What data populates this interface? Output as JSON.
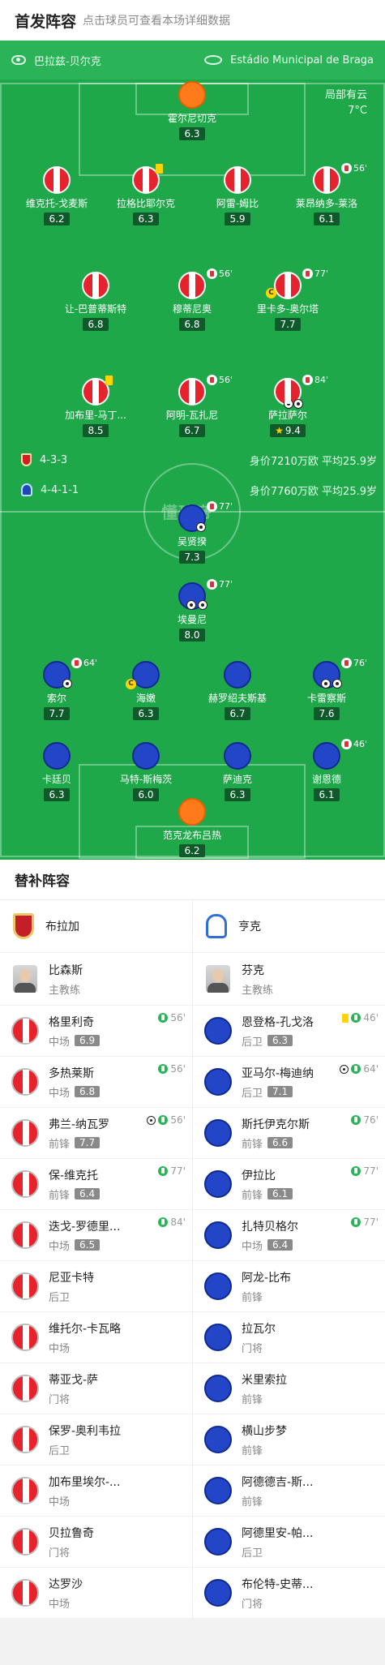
{
  "header": {
    "title": "首发阵容",
    "subtitle": "点击球员可查看本场详细数据"
  },
  "pitch": {
    "home_team": "巴拉兹-贝尔克",
    "stadium": "Estádio Municipal de Braga",
    "weather": "局部有云",
    "temperature": "7°C",
    "watermark": "懂球帝",
    "home_formation": "4-3-3",
    "home_value": "身价7210万欧 平均25.9岁",
    "away_formation": "4-4-1-1",
    "away_value": "身价7760万欧 平均25.9岁"
  },
  "home_players": [
    {
      "name": "霍尔尼切克",
      "rating": "6.3",
      "kit": "orange"
    },
    {
      "name": "维克托-戈麦斯",
      "rating": "6.2",
      "kit": "red"
    },
    {
      "name": "拉格比耶尔克",
      "rating": "6.3",
      "kit": "red"
    },
    {
      "name": "阿雷-姆比",
      "rating": "5.9",
      "kit": "red"
    },
    {
      "name": "莱昂纳多-莱洛",
      "rating": "6.1",
      "kit": "red",
      "sub": "56'"
    },
    {
      "name": "让-巴普蒂斯特",
      "rating": "6.8",
      "kit": "red"
    },
    {
      "name": "穆蒂尼奥",
      "rating": "6.8",
      "kit": "red",
      "sub": "56'"
    },
    {
      "name": "里卡多-奥尔塔",
      "rating": "7.7",
      "kit": "red",
      "sub": "77'"
    },
    {
      "name": "加布里-马丁...",
      "rating": "8.5",
      "kit": "red"
    },
    {
      "name": "阿明-瓦扎尼",
      "rating": "6.7",
      "kit": "red",
      "sub": "56'"
    },
    {
      "name": "萨拉萨尔",
      "rating": "9.4",
      "kit": "red",
      "sub": "84'"
    }
  ],
  "away_players": [
    {
      "name": "吴贤揆",
      "rating": "7.3",
      "kit": "blue",
      "sub": "77'"
    },
    {
      "name": "埃曼尼",
      "rating": "8.0",
      "kit": "blue",
      "sub": "77'"
    },
    {
      "name": "索尔",
      "rating": "7.7",
      "kit": "blue",
      "sub": "64'"
    },
    {
      "name": "海嫩",
      "rating": "6.3",
      "kit": "blue"
    },
    {
      "name": "赫罗绍夫斯基",
      "rating": "6.7",
      "kit": "blue"
    },
    {
      "name": "卡雷察斯",
      "rating": "7.6",
      "kit": "blue",
      "sub": "76'"
    },
    {
      "name": "卡廷贝",
      "rating": "6.3",
      "kit": "blue"
    },
    {
      "name": "马特-斯梅茨",
      "rating": "6.0",
      "kit": "blue"
    },
    {
      "name": "萨迪克",
      "rating": "6.3",
      "kit": "blue"
    },
    {
      "name": "谢恩德",
      "rating": "6.1",
      "kit": "blue",
      "sub": "46'"
    },
    {
      "name": "范克龙布吕热",
      "rating": "6.2",
      "kit": "orange"
    }
  ],
  "subs": {
    "title": "替补阵容",
    "home": {
      "team": "布拉加",
      "coach": "比森斯",
      "coach_role": "主教练",
      "players": [
        {
          "name": "格里利奇",
          "pos": "中场",
          "rating": "6.9",
          "in": "56'"
        },
        {
          "name": "多热莱斯",
          "pos": "中场",
          "rating": "6.8",
          "in": "56'"
        },
        {
          "name": "弗兰-纳瓦罗",
          "pos": "前锋",
          "rating": "7.7",
          "in": "56'"
        },
        {
          "name": "保-维克托",
          "pos": "前锋",
          "rating": "6.4",
          "in": "77'"
        },
        {
          "name": "迭戈-罗德里...",
          "pos": "中场",
          "rating": "6.5",
          "in": "84'"
        },
        {
          "name": "尼亚卡特",
          "pos": "后卫"
        },
        {
          "name": "维托尔-卡瓦略",
          "pos": "中场"
        },
        {
          "name": "蒂亚戈-萨",
          "pos": "门将"
        },
        {
          "name": "保罗-奥利韦拉",
          "pos": "后卫"
        },
        {
          "name": "加布里埃尔-...",
          "pos": "中场"
        },
        {
          "name": "贝拉鲁奇",
          "pos": "门将"
        },
        {
          "name": "达罗沙",
          "pos": "中场"
        }
      ]
    },
    "away": {
      "team": "亨克",
      "coach": "芬克",
      "coach_role": "主教练",
      "players": [
        {
          "name": "恩登格-孔戈洛",
          "pos": "后卫",
          "rating": "6.3",
          "in": "46'"
        },
        {
          "name": "亚马尔-梅迪纳",
          "pos": "后卫",
          "rating": "7.1",
          "in": "64'"
        },
        {
          "name": "斯托伊克尔斯",
          "pos": "前锋",
          "rating": "6.6",
          "in": "76'"
        },
        {
          "name": "伊拉比",
          "pos": "前锋",
          "rating": "6.1",
          "in": "77'"
        },
        {
          "name": "扎特贝格尔",
          "pos": "中场",
          "rating": "6.4",
          "in": "77'"
        },
        {
          "name": "阿龙-比布",
          "pos": "前锋"
        },
        {
          "name": "拉瓦尔",
          "pos": "门将"
        },
        {
          "name": "米里索拉",
          "pos": "前锋"
        },
        {
          "name": "横山步梦",
          "pos": "前锋"
        },
        {
          "name": "阿德德吉-斯...",
          "pos": "前锋"
        },
        {
          "name": "阿德里安-帕...",
          "pos": "后卫"
        },
        {
          "name": "布伦特-史蒂...",
          "pos": "门将"
        }
      ]
    }
  },
  "colors": {
    "pitch": "#1fa84a",
    "home_kit": "#e6222c",
    "away_kit": "#2346c9",
    "keeper": "#ff7a1a"
  }
}
